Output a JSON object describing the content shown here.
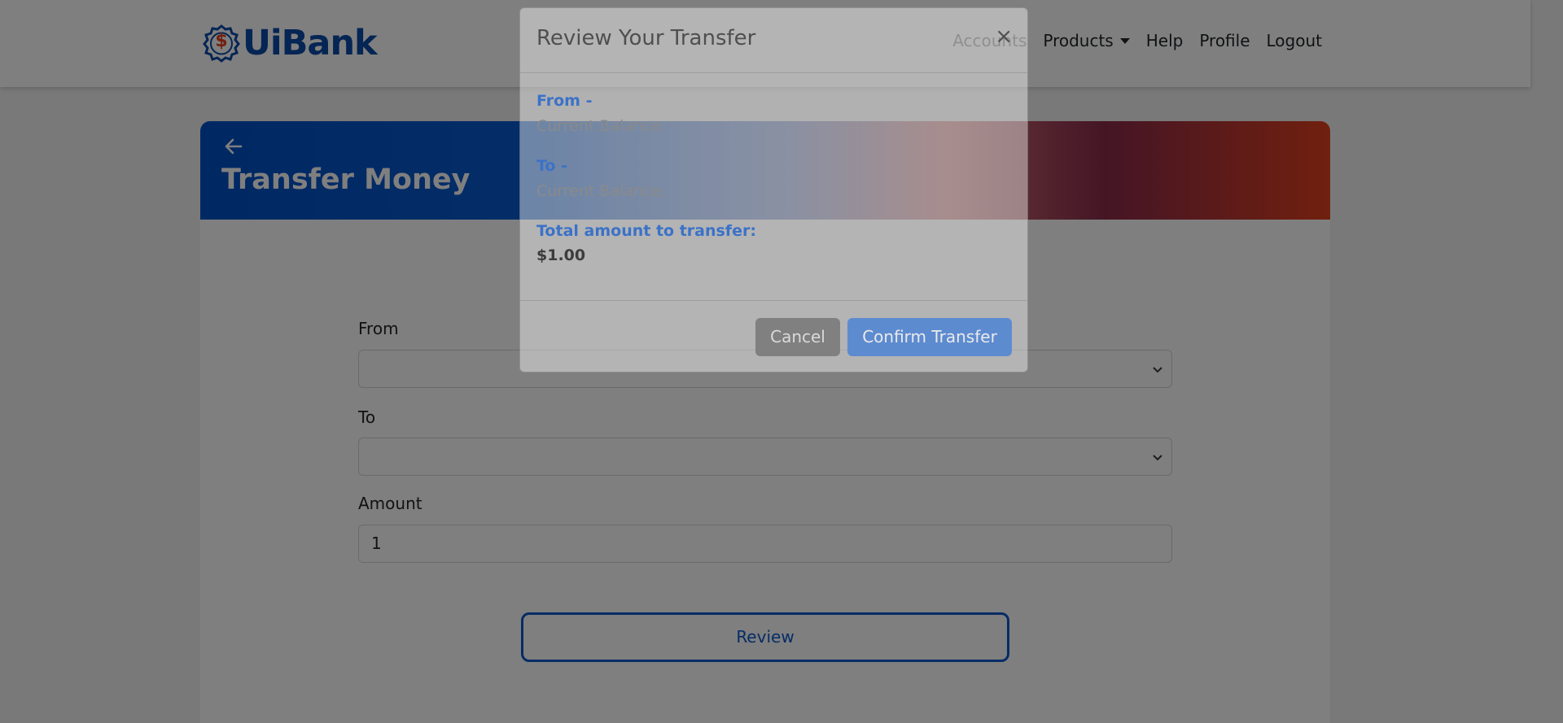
{
  "brand": {
    "name": "UiBank",
    "badge_symbol": "$"
  },
  "nav": {
    "accounts": "Accounts",
    "products": "Products",
    "help": "Help",
    "profile": "Profile",
    "logout": "Logout"
  },
  "page": {
    "title": "Transfer Money",
    "from_label": "From",
    "to_label": "To",
    "amount_label": "Amount",
    "amount_value": "1",
    "review_label": "Review"
  },
  "modal": {
    "title": "Review Your Transfer",
    "close": "×",
    "from_label": "From -",
    "from_balance": "Current Balance:",
    "to_label": "To -",
    "to_balance": "Current Balance:",
    "total_label": "Total amount to transfer:",
    "total_value": "$1.00",
    "cancel_label": "Cancel",
    "confirm_label": "Confirm Transfer"
  },
  "colors": {
    "brand_blue": "#0a4aa8",
    "accent_orange": "#e2401e",
    "primary": "#0a58ca"
  }
}
